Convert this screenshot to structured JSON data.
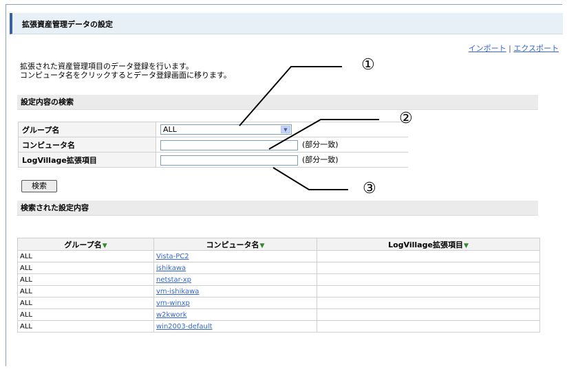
{
  "page": {
    "title": "拡張資産管理データの設定",
    "import_link": "インポート",
    "export_link": "エクスポート",
    "link_separator": "|",
    "description_lines": [
      "拡張された資産管理項目のデータ登録を行います。",
      "コンピュータ名をクリックするとデータ登録画面に移ります。"
    ]
  },
  "search": {
    "section_title": "設定内容の検索",
    "group_label": "グループ名",
    "group_value": "ALL",
    "computer_label": "コンピュータ名",
    "computer_value": "",
    "computer_hint": "(部分一致)",
    "ext_label": "LogVillage拡張項目",
    "ext_value": "",
    "ext_hint": "(部分一致)",
    "button_label": "検索"
  },
  "results": {
    "section_title": "検索された設定内容",
    "columns": [
      "グループ名",
      "コンピュータ名",
      "LogVillage拡張項目"
    ],
    "rows": [
      {
        "group": "ALL",
        "computer": "Vista-PC2",
        "ext": ""
      },
      {
        "group": "ALL",
        "computer": "ishikawa",
        "ext": ""
      },
      {
        "group": "ALL",
        "computer": "netstar-xp",
        "ext": ""
      },
      {
        "group": "ALL",
        "computer": "vm-ishikawa",
        "ext": ""
      },
      {
        "group": "ALL",
        "computer": "vm-winxp",
        "ext": ""
      },
      {
        "group": "ALL",
        "computer": "w2kwork",
        "ext": ""
      },
      {
        "group": "ALL",
        "computer": "win2003-default",
        "ext": ""
      }
    ]
  },
  "callouts": {
    "c1": "①",
    "c2": "②",
    "c3": "③"
  },
  "icons": {
    "sort": "sort-down-icon",
    "dropdown": "chevron-down-icon"
  },
  "colors": {
    "accent": "#3a5f9a",
    "header_bg": "#e7eff7",
    "link": "#3366cc",
    "sort_arrow": "#2e8b2e"
  }
}
